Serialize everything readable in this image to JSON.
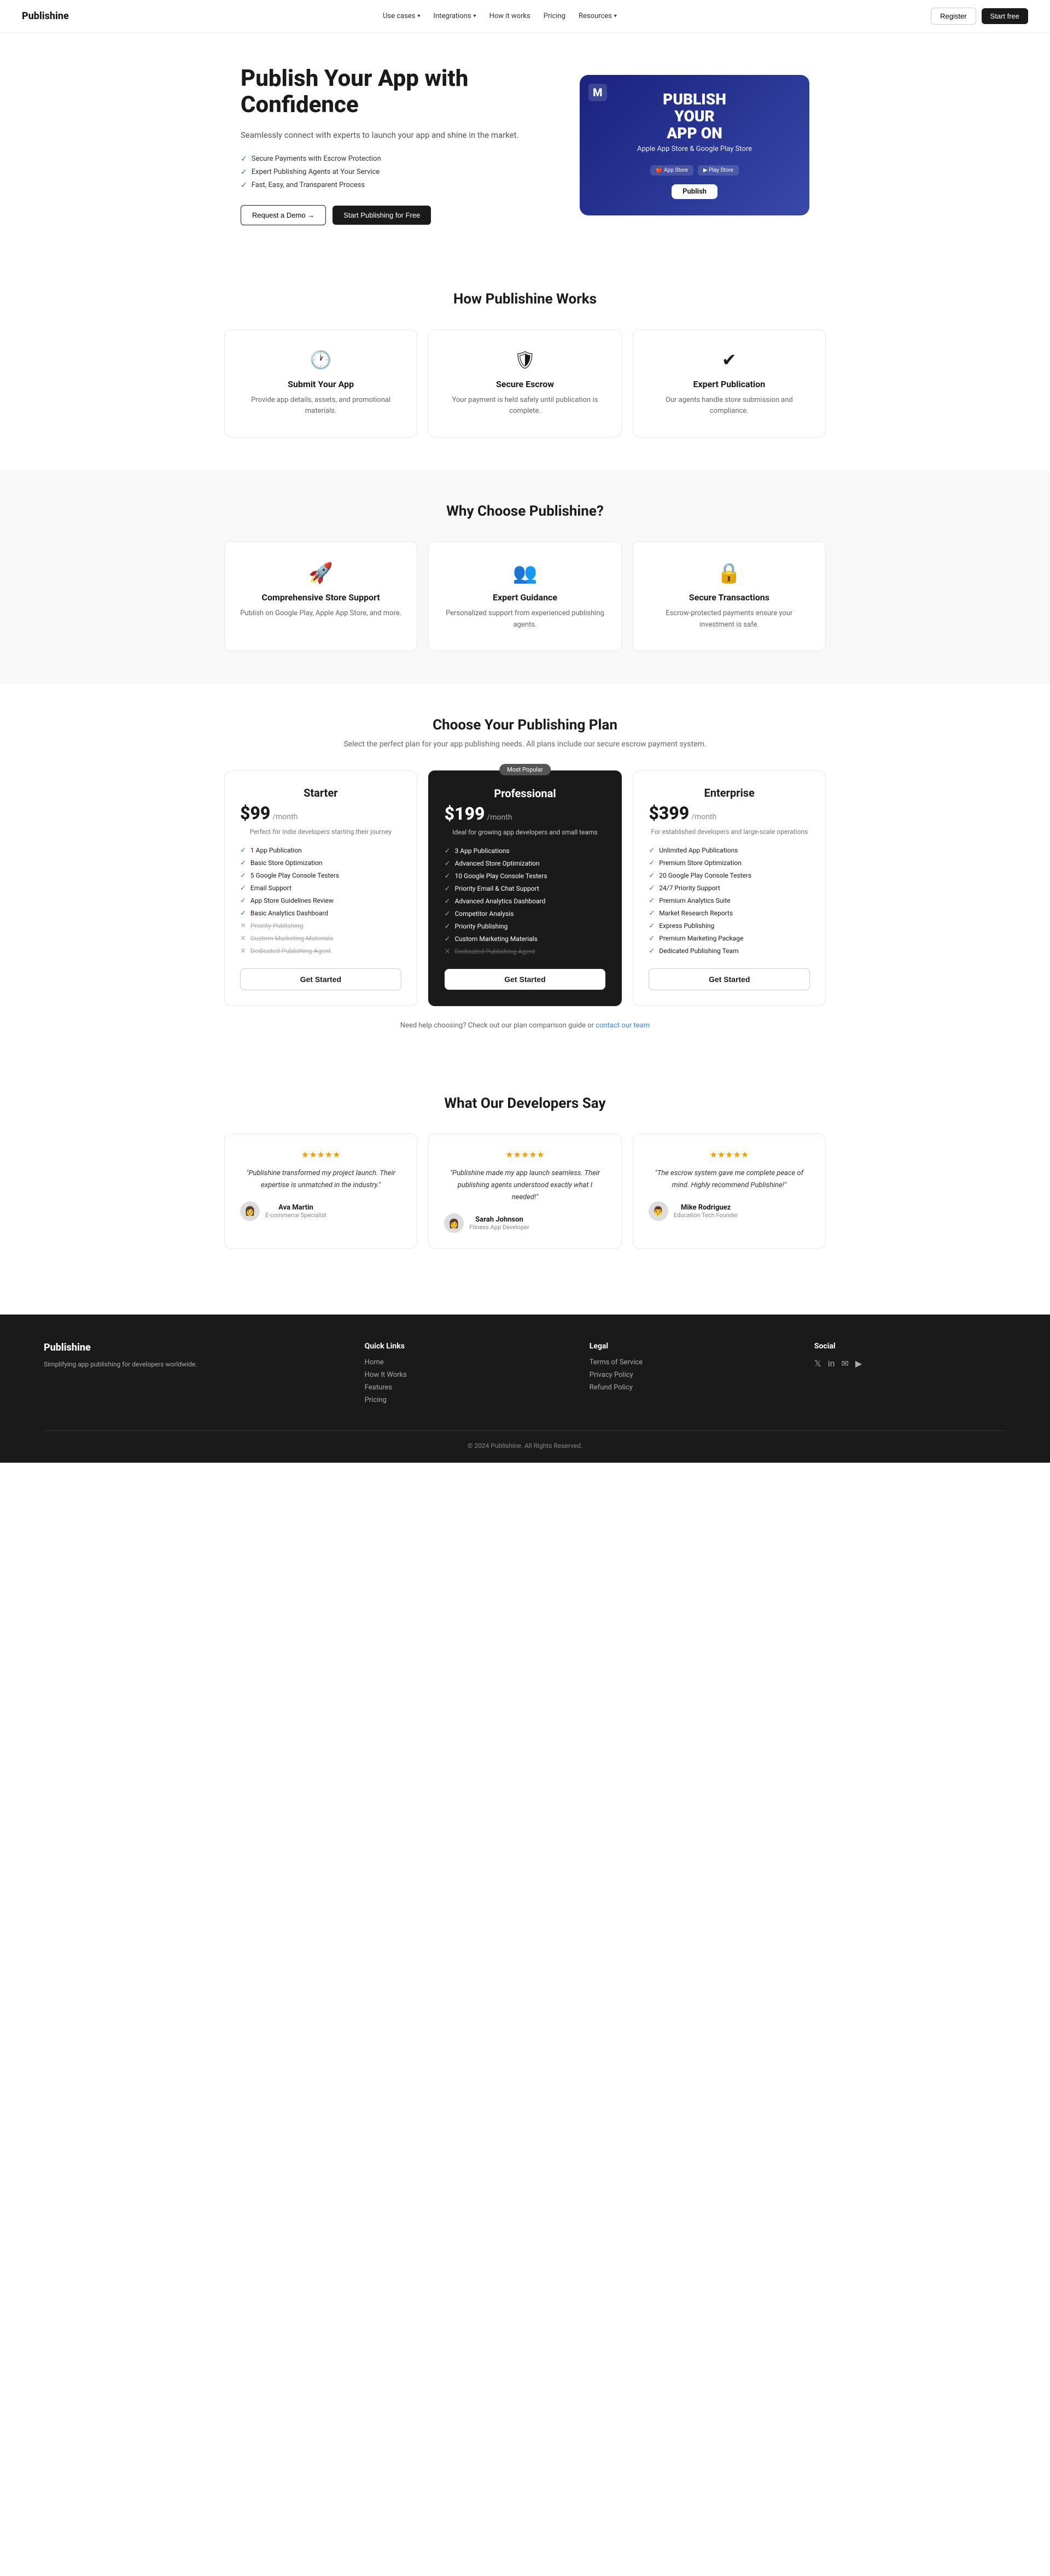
{
  "nav": {
    "logo": "Publishine",
    "links": [
      {
        "label": "Use cases",
        "has_dropdown": true
      },
      {
        "label": "Integrations",
        "has_dropdown": true
      },
      {
        "label": "How it works",
        "has_dropdown": false
      },
      {
        "label": "Pricing",
        "has_dropdown": false
      },
      {
        "label": "Resources",
        "has_dropdown": true
      }
    ],
    "register_label": "Register",
    "start_free_label": "Start free"
  },
  "hero": {
    "title": "Publish Your App with Confidence",
    "subtitle": "Seamlessly connect with experts to launch your app and shine in the market.",
    "checks": [
      "Secure Payments with Escrow Protection",
      "Expert Publishing Agents at Your Service",
      "Fast, Easy, and Transparent Process"
    ],
    "btn_demo": "Request a Demo →",
    "btn_publish": "Start Publishing for Free",
    "image": {
      "icon": "M",
      "title": "PUBLISH YOUR APP ON",
      "stores": "Apple App Store & Google Play Store",
      "btn": "Publish"
    }
  },
  "how_it_works": {
    "title": "How Publishine Works",
    "steps": [
      {
        "icon": "🕐",
        "title": "Submit Your App",
        "desc": "Provide app details, assets, and promotional materials."
      },
      {
        "icon": "🛡",
        "title": "Secure Escrow",
        "desc": "Your payment is held safely until publication is complete."
      },
      {
        "icon": "✔",
        "title": "Expert Publication",
        "desc": "Our agents handle store submission and compliance."
      }
    ]
  },
  "why": {
    "title": "Why Choose Publishine?",
    "items": [
      {
        "icon": "🚀",
        "title": "Comprehensive Store Support",
        "desc": "Publish on Google Play, Apple App Store, and more."
      },
      {
        "icon": "👥",
        "title": "Expert Guidance",
        "desc": "Personalized support from experienced publishing agents."
      },
      {
        "icon": "🔒",
        "title": "Secure Transactions",
        "desc": "Escrow-protected payments ensure your investment is safe."
      }
    ]
  },
  "pricing": {
    "title": "Choose Your Publishing Plan",
    "subtitle": "Select the perfect plan for your app publishing needs. All plans include our secure escrow payment system.",
    "plans": [
      {
        "name": "Starter",
        "price": "$99",
        "period": "/month",
        "desc": "Perfect for indie developers starting their journey",
        "popular": false,
        "features": [
          {
            "text": "1 App Publication",
            "active": true
          },
          {
            "text": "Basic Store Optimization",
            "active": true
          },
          {
            "text": "5 Google Play Console Testers",
            "active": true
          },
          {
            "text": "Email Support",
            "active": true
          },
          {
            "text": "App Store Guidelines Review",
            "active": true
          },
          {
            "text": "Basic Analytics Dashboard",
            "active": true
          },
          {
            "text": "Priority Publishing",
            "active": false
          },
          {
            "text": "Custom Marketing Materials",
            "active": false
          },
          {
            "text": "Dedicated Publishing Agent",
            "active": false
          }
        ],
        "btn": "Get Started"
      },
      {
        "name": "Professional",
        "price": "$199",
        "period": "/month",
        "desc": "Ideal for growing app developers and small teams",
        "popular": true,
        "popular_label": "Most Popular",
        "features": [
          {
            "text": "3 App Publications",
            "active": true
          },
          {
            "text": "Advanced Store Optimization",
            "active": true
          },
          {
            "text": "10 Google Play Console Testers",
            "active": true
          },
          {
            "text": "Priority Email & Chat Support",
            "active": true
          },
          {
            "text": "Advanced Analytics Dashboard",
            "active": true
          },
          {
            "text": "Competitor Analysis",
            "active": true
          },
          {
            "text": "Priority Publishing",
            "active": true
          },
          {
            "text": "Custom Marketing Materials",
            "active": true
          },
          {
            "text": "Dedicated Publishing Agent",
            "active": false
          }
        ],
        "btn": "Get Started"
      },
      {
        "name": "Enterprise",
        "price": "$399",
        "period": "/month",
        "desc": "For established developers and large-scale operations",
        "popular": false,
        "features": [
          {
            "text": "Unlimited App Publications",
            "active": true
          },
          {
            "text": "Premium Store Optimization",
            "active": true
          },
          {
            "text": "20 Google Play Console Testers",
            "active": true
          },
          {
            "text": "24/7 Priority Support",
            "active": true
          },
          {
            "text": "Premium Analytics Suite",
            "active": true
          },
          {
            "text": "Market Research Reports",
            "active": true
          },
          {
            "text": "Express Publishing",
            "active": true
          },
          {
            "text": "Premium Marketing Package",
            "active": true
          },
          {
            "text": "Dedicated Publishing Team",
            "active": true
          }
        ],
        "btn": "Get Started"
      }
    ],
    "note": "Need help choosing? Check out our plan comparison guide or",
    "note_link": "contact our team"
  },
  "testimonials": {
    "title": "What Our Developers Say",
    "items": [
      {
        "stars": "★★★★★",
        "quote": "\"Publishine transformed my project launch. Their expertise is unmatched in the industry.\"",
        "name": "Ava Martin",
        "role": "E-commerce Specialist",
        "avatar": "👩"
      },
      {
        "stars": "★★★★★",
        "quote": "\"Publishine made my app launch seamless. Their publishing agents understood exactly what I needed!\"",
        "name": "Sarah Johnson",
        "role": "Fitness App Developer",
        "avatar": "👩"
      },
      {
        "stars": "★★★★★",
        "quote": "\"The escrow system gave me complete peace of mind. Highly recommend Publishine!\"",
        "name": "Mike Rodriguez",
        "role": "Education Tech Founder",
        "avatar": "👨"
      }
    ]
  },
  "footer": {
    "brand": "Publishine",
    "brand_desc": "Simplifying app publishing for developers worldwide.",
    "sections": [
      {
        "title": "Quick Links",
        "links": [
          "Home",
          "How It Works",
          "Features",
          "Pricing"
        ]
      },
      {
        "title": "Legal",
        "links": [
          "Terms of Service",
          "Privacy Policy",
          "Refund Policy"
        ]
      },
      {
        "title": "Social",
        "links": []
      }
    ],
    "social_icons": [
      "𝕏",
      "in",
      "✉",
      "▶"
    ],
    "copyright": "© 2024 Publishine. All Rights Reserved."
  }
}
